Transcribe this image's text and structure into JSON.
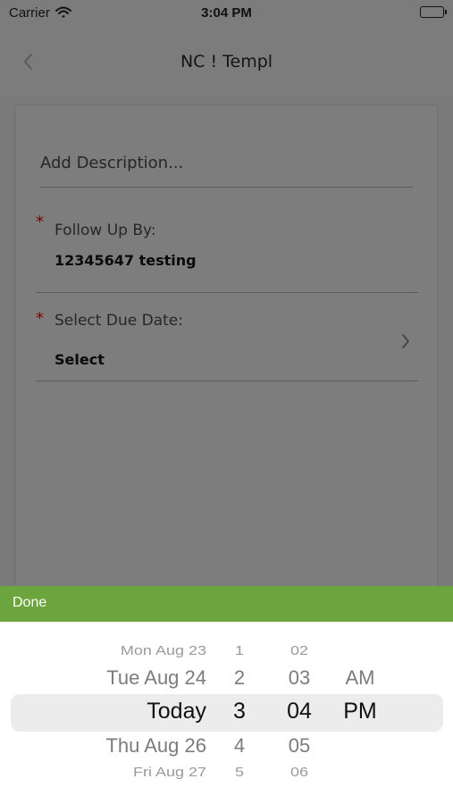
{
  "status_bar": {
    "carrier": "Carrier",
    "time": "3:04 PM"
  },
  "nav": {
    "title": "NC ! Templ",
    "back_icon": "chevron-left-icon"
  },
  "form": {
    "description_placeholder": "Add Description...",
    "follow_up": {
      "required_mark": "*",
      "label": "Follow Up By:",
      "value": "12345647 testing"
    },
    "due_date": {
      "required_mark": "*",
      "label": "Select Due Date:",
      "value": "Select",
      "chevron_icon": "chevron-right-icon"
    }
  },
  "toolbar": {
    "done_label": "Done",
    "color": "#6ca43d"
  },
  "picker": {
    "dates": [
      "Mon Aug 23",
      "Tue Aug 24",
      "Today",
      "Thu Aug 26",
      "Fri Aug 27"
    ],
    "hours": [
      "1",
      "2",
      "3",
      "4",
      "5"
    ],
    "minutes": [
      "02",
      "03",
      "04",
      "05",
      "06"
    ],
    "ampm": [
      "AM",
      "PM"
    ],
    "selected": {
      "date": "Today",
      "hour": "3",
      "minute": "04",
      "ampm": "PM"
    }
  }
}
